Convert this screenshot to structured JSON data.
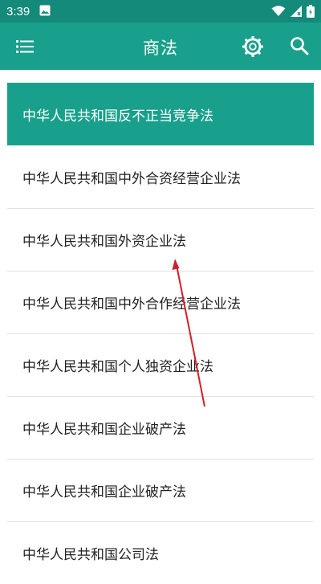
{
  "status_bar": {
    "time": "3:39",
    "icons": [
      "image-notification-icon",
      "wifi-icon",
      "cell-signal-icon",
      "battery-icon"
    ]
  },
  "app_bar": {
    "title": "商法",
    "menu_icon": "list-menu-icon",
    "settings_icon": "gear-icon",
    "search_icon": "search-icon",
    "color": "#19a08c"
  },
  "law_list": {
    "selected_index": 0,
    "items": [
      "中华人民共和国反不正当竞争法",
      "中华人民共和国中外合资经营企业法",
      "中华人民共和国外资企业法",
      "中华人民共和国中外合作经营企业法",
      "中华人民共和国个人独资企业法",
      "中华人民共和国企业破产法",
      "中华人民共和国企业破产法",
      "中华人民共和国公司法"
    ]
  },
  "annotation": {
    "type": "arrow",
    "color": "#d0202a"
  }
}
